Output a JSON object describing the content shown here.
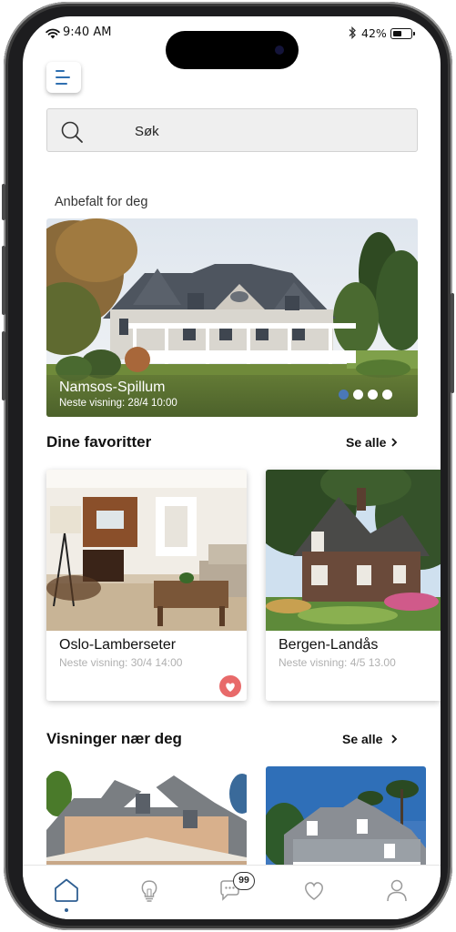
{
  "status_bar": {
    "time": "9:40 AM",
    "battery": "42%"
  },
  "search": {
    "placeholder": "Søk"
  },
  "recommended": {
    "heading": "Anbefalt for deg",
    "title": "Namsos-Spillum",
    "subtitle": "Neste visning: 28/4 10:00",
    "slide_count": 4,
    "active_slide": 1
  },
  "favorites": {
    "heading": "Dine favoritter",
    "see_all": "Se alle",
    "items": [
      {
        "name": "Oslo-Lamberseter",
        "subtitle": "Neste visning: 30/4 14:00",
        "favorited": true
      },
      {
        "name": "Bergen-Landås",
        "subtitle": "Neste visning: 4/5 13.00",
        "favorited": false
      }
    ]
  },
  "nearby": {
    "heading": "Visninger nær deg",
    "see_all": "Se alle"
  },
  "tabbar": {
    "messages_badge": "99"
  },
  "colors": {
    "accent": "#2f6fb0",
    "active_dot": "#4a78b8",
    "heart": "#e86a6a"
  }
}
